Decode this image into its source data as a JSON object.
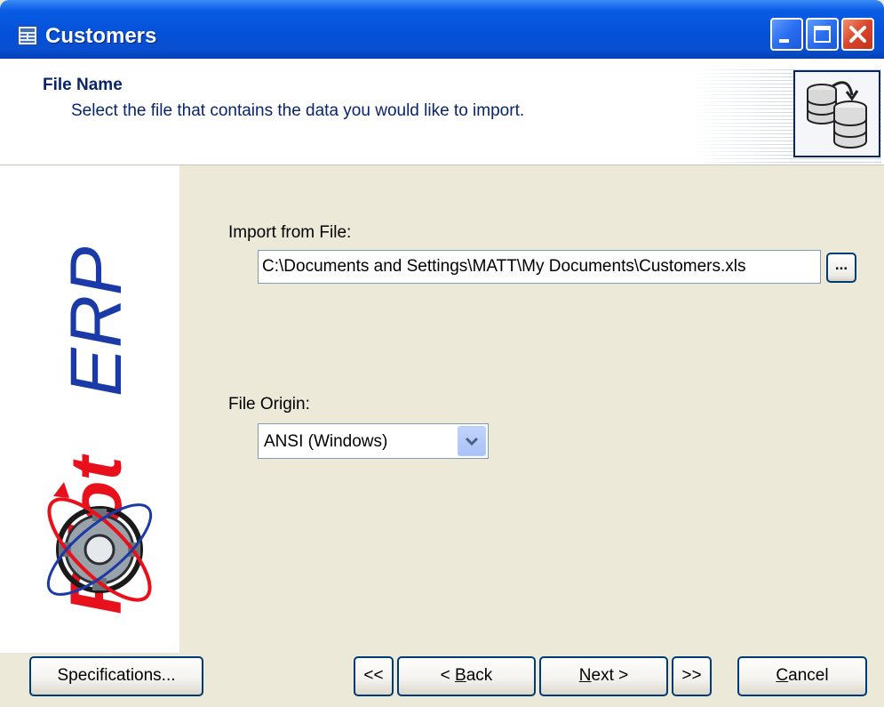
{
  "window": {
    "title": "Customers",
    "icon": "app-window-icon"
  },
  "header": {
    "title": "File Name",
    "subtitle": "Select the file that contains the data you would like to import.",
    "image_icon": "database-import-icon"
  },
  "brand": {
    "logo_text_bold": "Pilot",
    "logo_text_light": "ERP"
  },
  "import_file": {
    "label": "Import from File:",
    "value": "C:\\Documents and Settings\\MATT\\My Documents\\Customers.xls",
    "browse_label": "..."
  },
  "file_origin": {
    "label": "File Origin:",
    "selected": "ANSI (Windows)"
  },
  "buttons": {
    "specifications": "Specifications...",
    "first": "<<",
    "back_prefix": "< ",
    "back_ul": "B",
    "back_rest": "ack",
    "next_ul": "N",
    "next_rest": "ext >",
    "last": ">>",
    "cancel_ul": "C",
    "cancel_rest": "ancel"
  },
  "colors": {
    "titlebar": "#0450d8",
    "header_text": "#0a246a",
    "brand_blue": "#1a3aa8",
    "brand_red": "#e8101a"
  }
}
